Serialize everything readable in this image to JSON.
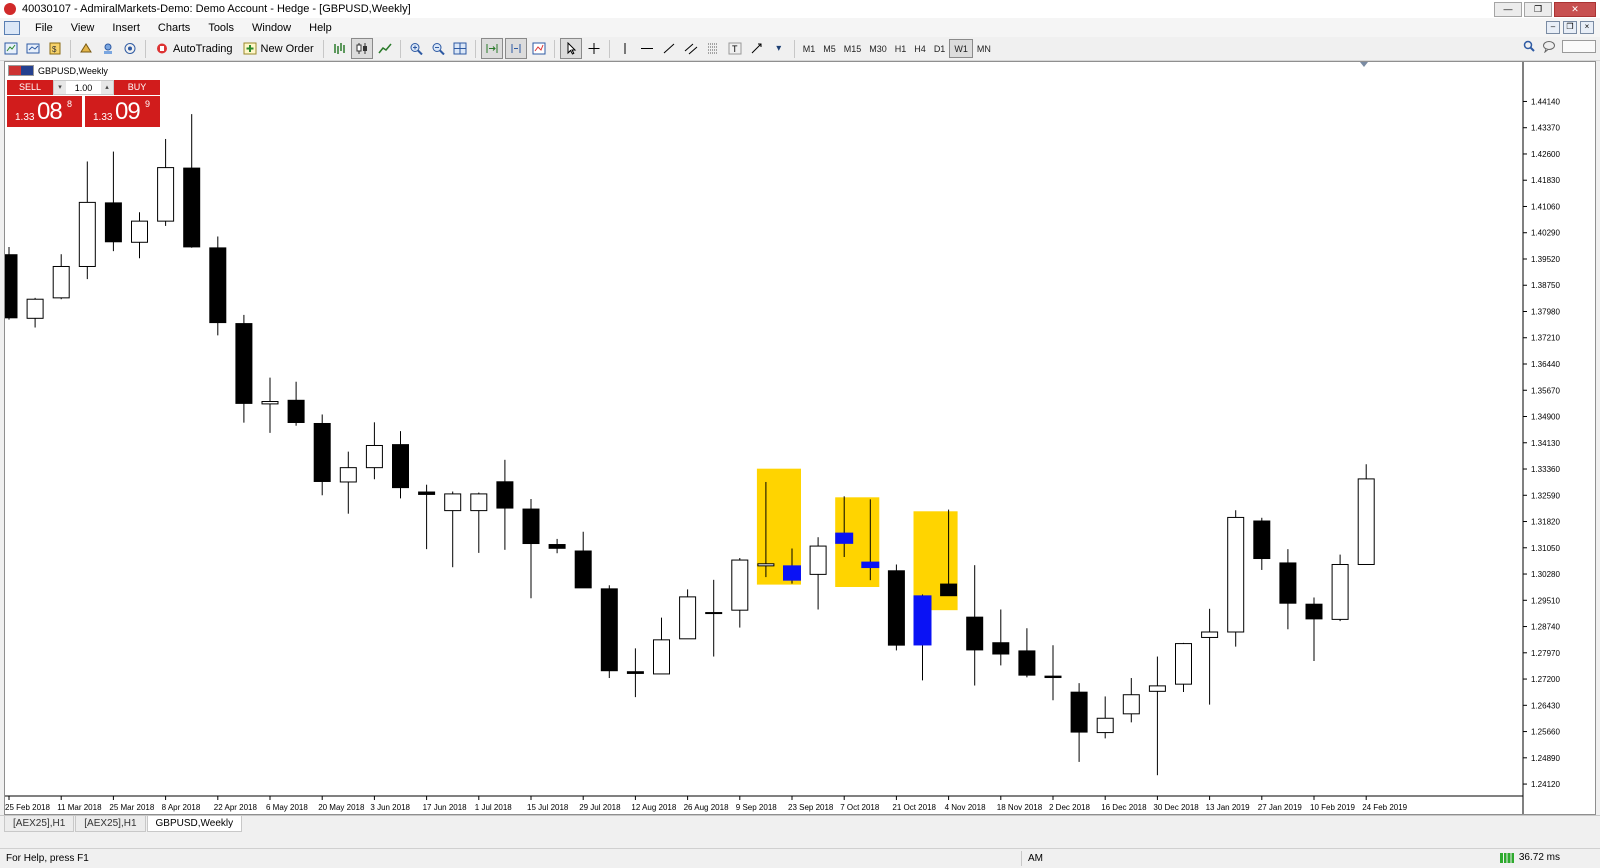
{
  "window": {
    "title": "40030107 - AdmiralMarkets-Demo: Demo Account - Hedge - [GBPUSD,Weekly]"
  },
  "menu": {
    "items": [
      "File",
      "View",
      "Insert",
      "Charts",
      "Tools",
      "Window",
      "Help"
    ]
  },
  "toolbar": {
    "autotrading_label": "AutoTrading",
    "new_order_label": "New Order",
    "timeframes": [
      "M1",
      "M5",
      "M15",
      "M30",
      "H1",
      "H4",
      "D1",
      "W1",
      "MN"
    ],
    "selected_timeframe": "W1"
  },
  "chart": {
    "label": "GBPUSD,Weekly",
    "trade_panel": {
      "sell_label": "SELL",
      "buy_label": "BUY",
      "lot": "1.00",
      "sell_price_small": "1.33",
      "sell_price_big": "08",
      "sell_price_sup": "8",
      "buy_price_small": "1.33",
      "buy_price_big": "09",
      "buy_price_sup": "9"
    }
  },
  "chart_data": {
    "type": "candlestick",
    "symbol": "GBPUSD",
    "timeframe": "Weekly",
    "y_ticks": [
      "1.44140",
      "1.43370",
      "1.42600",
      "1.41830",
      "1.41060",
      "1.40290",
      "1.39520",
      "1.38750",
      "1.37980",
      "1.37210",
      "1.36440",
      "1.35670",
      "1.34900",
      "1.34130",
      "1.33360",
      "1.32590",
      "1.31820",
      "1.31050",
      "1.30280",
      "1.29510",
      "1.28740",
      "1.27970",
      "1.27200",
      "1.26430",
      "1.25660",
      "1.24890",
      "1.24120"
    ],
    "ylim": [
      1.2377,
      1.4518
    ],
    "x_labels": [
      "25 Feb 2018",
      "11 Mar 2018",
      "25 Mar 2018",
      "8 Apr 2018",
      "22 Apr 2018",
      "6 May 2018",
      "20 May 2018",
      "3 Jun 2018",
      "17 Jun 2018",
      "1 Jul 2018",
      "15 Jul 2018",
      "29 Jul 2018",
      "12 Aug 2018",
      "26 Aug 2018",
      "9 Sep 2018",
      "23 Sep 2018",
      "7 Oct 2018",
      "21 Oct 2018",
      "4 Nov 2018",
      "18 Nov 2018",
      "2 Dec 2018",
      "16 Dec 2018",
      "30 Dec 2018",
      "13 Jan 2019",
      "27 Jan 2019",
      "10 Feb 2019",
      "24 Feb 2019"
    ],
    "candles": [
      {
        "o": 1.3966,
        "h": 1.3987,
        "l": 1.3774,
        "c": 1.3778
      },
      {
        "o": 1.3778,
        "h": 1.3838,
        "l": 1.3751,
        "c": 1.3834
      },
      {
        "o": 1.3838,
        "h": 1.3966,
        "l": 1.3834,
        "c": 1.393
      },
      {
        "o": 1.393,
        "h": 1.4238,
        "l": 1.3893,
        "c": 1.4118
      },
      {
        "o": 1.4118,
        "h": 1.4267,
        "l": 1.3975,
        "c": 1.4001
      },
      {
        "o": 1.4001,
        "h": 1.4089,
        "l": 1.3954,
        "c": 1.4063
      },
      {
        "o": 1.4063,
        "h": 1.4304,
        "l": 1.4049,
        "c": 1.422
      },
      {
        "o": 1.422,
        "h": 1.4377,
        "l": 1.3985,
        "c": 1.3986
      },
      {
        "o": 1.3986,
        "h": 1.4018,
        "l": 1.3728,
        "c": 1.3764
      },
      {
        "o": 1.3764,
        "h": 1.3788,
        "l": 1.3472,
        "c": 1.3527
      },
      {
        "o": 1.3527,
        "h": 1.3604,
        "l": 1.3442,
        "c": 1.3534
      },
      {
        "o": 1.3539,
        "h": 1.3592,
        "l": 1.3463,
        "c": 1.3471
      },
      {
        "o": 1.3471,
        "h": 1.3496,
        "l": 1.3259,
        "c": 1.3298
      },
      {
        "o": 1.3298,
        "h": 1.3387,
        "l": 1.3205,
        "c": 1.334
      },
      {
        "o": 1.334,
        "h": 1.3473,
        "l": 1.3306,
        "c": 1.3405
      },
      {
        "o": 1.3409,
        "h": 1.3447,
        "l": 1.325,
        "c": 1.328
      },
      {
        "o": 1.327,
        "h": 1.329,
        "l": 1.3101,
        "c": 1.326
      },
      {
        "o": 1.3214,
        "h": 1.327,
        "l": 1.3048,
        "c": 1.3263
      },
      {
        "o": 1.3214,
        "h": 1.3267,
        "l": 1.309,
        "c": 1.3263
      },
      {
        "o": 1.33,
        "h": 1.3363,
        "l": 1.3099,
        "c": 1.322
      },
      {
        "o": 1.322,
        "h": 1.3248,
        "l": 1.2957,
        "c": 1.3116
      },
      {
        "o": 1.3116,
        "h": 1.3131,
        "l": 1.3089,
        "c": 1.3102
      },
      {
        "o": 1.3097,
        "h": 1.3152,
        "l": 1.3,
        "c": 1.2986
      },
      {
        "o": 1.2986,
        "h": 1.2995,
        "l": 1.2723,
        "c": 1.2743
      },
      {
        "o": 1.2743,
        "h": 1.281,
        "l": 1.2667,
        "c": 1.2735
      },
      {
        "o": 1.2735,
        "h": 1.29,
        "l": 1.274,
        "c": 1.2835
      },
      {
        "o": 1.2838,
        "h": 1.2983,
        "l": 1.2838,
        "c": 1.2961
      },
      {
        "o": 1.2915,
        "h": 1.3011,
        "l": 1.2786,
        "c": 1.2915
      },
      {
        "o": 1.2922,
        "h": 1.3075,
        "l": 1.2871,
        "c": 1.3069
      },
      {
        "o": 1.3052,
        "h": 1.3298,
        "l": 1.3019,
        "c": 1.3058
      },
      {
        "o": 1.3052,
        "h": 1.3103,
        "l": 1.3,
        "c": 1.301
      },
      {
        "o": 1.3027,
        "h": 1.3136,
        "l": 1.2924,
        "c": 1.311
      },
      {
        "o": 1.3118,
        "h": 1.3256,
        "l": 1.3078,
        "c": 1.3148
      },
      {
        "o": 1.3047,
        "h": 1.3247,
        "l": 1.301,
        "c": 1.3063
      },
      {
        "o": 1.3039,
        "h": 1.3056,
        "l": 1.2804,
        "c": 1.2818
      },
      {
        "o": 1.282,
        "h": 1.2968,
        "l": 1.2716,
        "c": 1.2964
      },
      {
        "o": 1.3,
        "h": 1.3217,
        "l": 1.2968,
        "c": 1.2963
      },
      {
        "o": 1.2903,
        "h": 1.3054,
        "l": 1.2701,
        "c": 1.2804
      },
      {
        "o": 1.2828,
        "h": 1.2924,
        "l": 1.276,
        "c": 1.2792
      },
      {
        "o": 1.2804,
        "h": 1.2869,
        "l": 1.2725,
        "c": 1.273
      },
      {
        "o": 1.273,
        "h": 1.2819,
        "l": 1.2658,
        "c": 1.2723
      },
      {
        "o": 1.2683,
        "h": 1.2708,
        "l": 1.2477,
        "c": 1.2563
      },
      {
        "o": 1.2563,
        "h": 1.2669,
        "l": 1.2546,
        "c": 1.2605
      },
      {
        "o": 1.2618,
        "h": 1.2723,
        "l": 1.2593,
        "c": 1.2674
      },
      {
        "o": 1.2684,
        "h": 1.2786,
        "l": 1.2438,
        "c": 1.27
      },
      {
        "o": 1.2705,
        "h": 1.2826,
        "l": 1.2682,
        "c": 1.2824
      },
      {
        "o": 1.2842,
        "h": 1.2926,
        "l": 1.2645,
        "c": 1.2858
      },
      {
        "o": 1.2858,
        "h": 1.3215,
        "l": 1.2815,
        "c": 1.3194
      },
      {
        "o": 1.3185,
        "h": 1.3193,
        "l": 1.304,
        "c": 1.3072
      },
      {
        "o": 1.3062,
        "h": 1.3101,
        "l": 1.2866,
        "c": 1.2941
      },
      {
        "o": 1.2941,
        "h": 1.2959,
        "l": 1.2773,
        "c": 1.2895
      },
      {
        "o": 1.2895,
        "h": 1.3085,
        "l": 1.289,
        "c": 1.3056
      },
      {
        "o": 1.3056,
        "h": 1.335,
        "l": 1.3056,
        "c": 1.3307
      }
    ],
    "highlight_zones": [
      {
        "start": 29,
        "end": 30,
        "high": 1.3337,
        "low": 1.2997,
        "color": "#FFD400"
      },
      {
        "start": 32,
        "end": 33,
        "high": 1.3253,
        "low": 1.299,
        "color": "#FFD400"
      },
      {
        "start": 35,
        "end": 36,
        "high": 1.3212,
        "low": 1.2922,
        "color": "#FFD400"
      }
    ],
    "blue_candles": [
      30,
      32,
      33,
      35
    ],
    "colors": {
      "bull": "#ffffff",
      "bear": "#000000",
      "outline": "#000000",
      "highlight": "#FFD400",
      "blue": "#0A12F5"
    }
  },
  "tabs": [
    "[AEX25],H1",
    "[AEX25],H1",
    "GBPUSD,Weekly"
  ],
  "active_tab": 2,
  "status": {
    "help_text": "For Help, press F1",
    "mode": "AM",
    "ping": "36.72 ms"
  }
}
